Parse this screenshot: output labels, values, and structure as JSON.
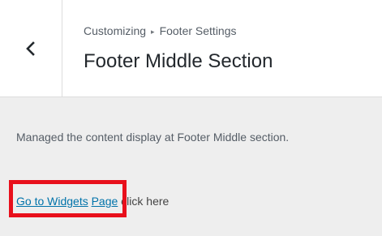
{
  "header": {
    "back_icon": "chevron-left-icon",
    "breadcrumb_root": "Customizing",
    "breadcrumb_separator": "▸",
    "breadcrumb_parent": "Footer Settings",
    "title": "Footer Middle Section"
  },
  "content": {
    "description": "Managed the content display at Footer Middle section.",
    "widgets_link_part1": "Go to Widgets",
    "widgets_link_part2": "Page",
    "trailing_text": " click here"
  },
  "colors": {
    "link": "#0073aa",
    "highlight": "#e8101c",
    "panel_bg": "#eeeeee"
  }
}
